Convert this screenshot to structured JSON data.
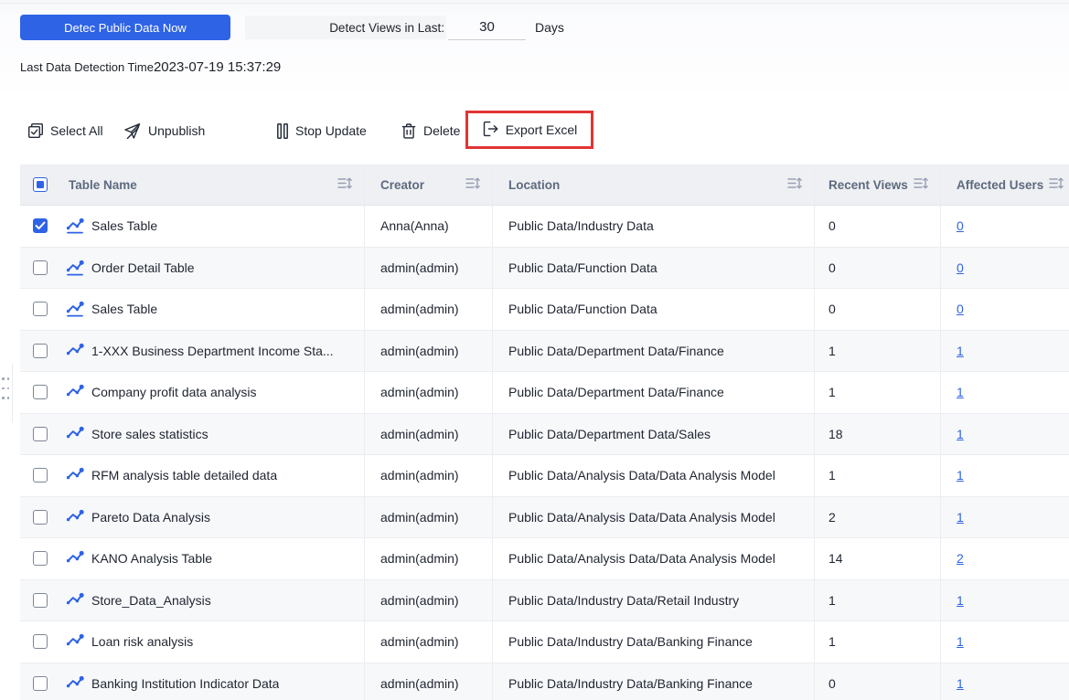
{
  "top": {
    "detect_button_label": "Detec Public Data Now",
    "detect_views_label": "Detect Views in Last:",
    "days_value": "30",
    "days_unit": "Days",
    "last_detection_label": "Last Data Detection Time",
    "last_detection_time": "2023-07-19 15:37:29"
  },
  "toolbar": {
    "items": [
      {
        "label": "Select All",
        "icon": "select-all-icon"
      },
      {
        "label": "Unpublish",
        "icon": "unpublish-icon"
      },
      {
        "label": "Stop Update",
        "icon": "stop-update-icon"
      },
      {
        "label": "Delete",
        "icon": "delete-icon"
      },
      {
        "label": "Export Excel",
        "icon": "export-excel-icon",
        "highlighted": true
      }
    ],
    "export_highlight_color": "#e23434"
  },
  "table": {
    "select_all_state": "indeterminate",
    "columns": [
      "Table Name",
      "Creator",
      "Location",
      "Recent Views",
      "Affected Users"
    ],
    "rows": [
      {
        "name": "Sales Table",
        "creator": "Anna(Anna)",
        "location": "Public Data/Industry Data",
        "recent_views": "0",
        "affected_users": "0",
        "checked": true,
        "icon": "chart-line-underline-icon"
      },
      {
        "name": "Order Detail Table",
        "creator": "admin(admin)",
        "location": "Public Data/Function Data",
        "recent_views": "0",
        "affected_users": "0",
        "checked": false,
        "icon": "chart-line-underline-icon"
      },
      {
        "name": "Sales Table",
        "creator": "admin(admin)",
        "location": "Public Data/Function Data",
        "recent_views": "0",
        "affected_users": "0",
        "checked": false,
        "icon": "chart-line-underline-icon"
      },
      {
        "name": "1-XXX Business Department Income Sta...",
        "creator": "admin(admin)",
        "location": "Public Data/Department Data/Finance",
        "recent_views": "1",
        "affected_users": "1",
        "checked": false,
        "icon": "chart-line-icon"
      },
      {
        "name": "Company profit data analysis",
        "creator": "admin(admin)",
        "location": "Public Data/Department Data/Finance",
        "recent_views": "1",
        "affected_users": "1",
        "checked": false,
        "icon": "chart-line-icon"
      },
      {
        "name": "Store sales statistics",
        "creator": "admin(admin)",
        "location": "Public Data/Department Data/Sales",
        "recent_views": "18",
        "affected_users": "1",
        "checked": false,
        "icon": "chart-line-icon"
      },
      {
        "name": "RFM analysis table detailed data",
        "creator": "admin(admin)",
        "location": "Public Data/Analysis Data/Data Analysis Model",
        "recent_views": "1",
        "affected_users": "1",
        "checked": false,
        "icon": "chart-line-icon"
      },
      {
        "name": "Pareto Data Analysis",
        "creator": "admin(admin)",
        "location": "Public Data/Analysis Data/Data Analysis Model",
        "recent_views": "2",
        "affected_users": "1",
        "checked": false,
        "icon": "chart-line-icon"
      },
      {
        "name": "KANO Analysis Table",
        "creator": "admin(admin)",
        "location": "Public Data/Analysis Data/Data Analysis Model",
        "recent_views": "14",
        "affected_users": "2",
        "checked": false,
        "icon": "chart-line-icon"
      },
      {
        "name": "Store_Data_Analysis",
        "creator": "admin(admin)",
        "location": "Public Data/Industry Data/Retail Industry",
        "recent_views": "1",
        "affected_users": "1",
        "checked": false,
        "icon": "chart-line-icon"
      },
      {
        "name": "Loan risk analysis",
        "creator": "admin(admin)",
        "location": "Public Data/Industry Data/Banking Finance",
        "recent_views": "1",
        "affected_users": "1",
        "checked": false,
        "icon": "chart-line-icon"
      },
      {
        "name": "Banking Institution Indicator Data",
        "creator": "admin(admin)",
        "location": "Public Data/Industry Data/Banking Finance",
        "recent_views": "0",
        "affected_users": "1",
        "checked": false,
        "icon": "chart-line-icon"
      }
    ]
  },
  "colors": {
    "accent_blue": "#2e63e6",
    "highlight_red": "#e23434",
    "header_bg": "#eef0f3",
    "zebra_bg": "#f7f8fa",
    "border": "#ebedf0",
    "text_dark": "#1f2430",
    "header_text": "#5d6a7e"
  }
}
